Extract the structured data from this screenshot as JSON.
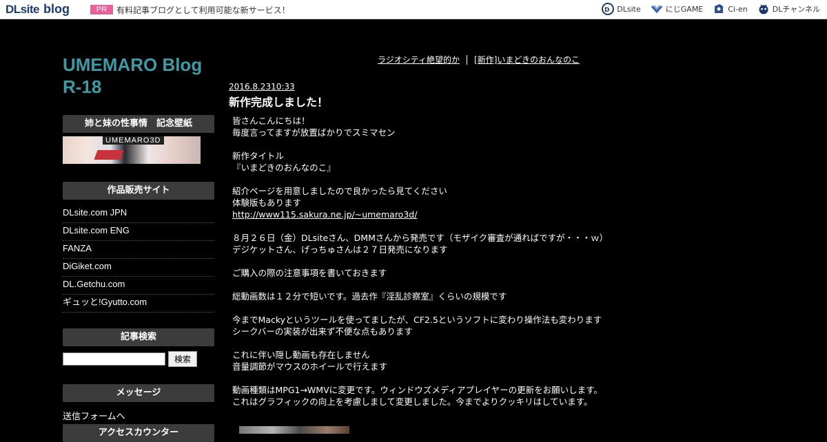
{
  "topbar": {
    "logo_dl": "DLsite",
    "logo_blog": "blog",
    "pr_badge": "PR",
    "pr_text": "有料記事ブログとして利用可能な新サービス！",
    "links": [
      {
        "label": "DLsite",
        "icon": "dlsite-icon"
      },
      {
        "label": "にじGAME",
        "icon": "nijigame-icon"
      },
      {
        "label": "Ci-en",
        "icon": "ci-en-icon"
      },
      {
        "label": "DLチャンネル",
        "icon": "dlchannel-icon"
      }
    ]
  },
  "blog": {
    "title_line1": "UMEMARO Blog",
    "title_line2": "R-18",
    "title_color": "#3d9aa6"
  },
  "sidebar": {
    "wallpaper_heading": "姉と妹の性事情　記念壁紙",
    "banner_text": "UMEMARO3D",
    "shops_heading": "作品販売サイト",
    "shops": [
      "DLsite.com JPN",
      "DLsite.com ENG",
      "FANZA",
      "DiGiket.com",
      "DL.Getchu.com",
      "ギュッと!Gyutto.com"
    ],
    "search_heading": "記事検索",
    "search_value": "",
    "search_button": "検索",
    "message_heading": "メッセージ",
    "message_link": "送信フォームへ",
    "counter_heading": "アクセスカウンター"
  },
  "nav": {
    "prev": "ラジオシティ絶望的か",
    "next": "[新作]いまどきのおんなのこ"
  },
  "post": {
    "date": "2016.8.2310:33",
    "title": "新作完成しました！",
    "lines": [
      "皆さんこんにちは！",
      "毎度言ってますが放置ばかりでスミマセン",
      "",
      "新作タイトル",
      "『いまどきのおんなのこ』",
      "",
      "紹介ページを用意しましたので良かったら見てください",
      "体験版もあります",
      "http://www115.sakura.ne.jp/~umemaro3d/",
      "",
      "８月２６日（金）DLsiteさん、DMMさんから発売です（モザイク審査が通ればですが・・・ｗ）",
      "デジケットさん、げっちゅさんは２７日発売になります",
      "",
      "ご購入の際の注意事項を書いておきます",
      "",
      "総動画数は１２分で短いです。過去作『淫乱診察室』くらいの規模です",
      "",
      "今までMackyというツールを使ってましたが、CF2.5というソフトに変わり操作法も変わります",
      "シークバーの実装が出来ず不便な点もあります",
      "",
      "これに伴い隠し動画も存在しません",
      "音量調節がマウスのホイールで行えます",
      "",
      "動画種類はMPG1→WMVに変更です。ウィンドウズメディアプレイヤーの更新をお願いします。",
      "これはグラフィックの向上を考慮しまして変更しました。今までよりクッキリはしています。"
    ]
  }
}
